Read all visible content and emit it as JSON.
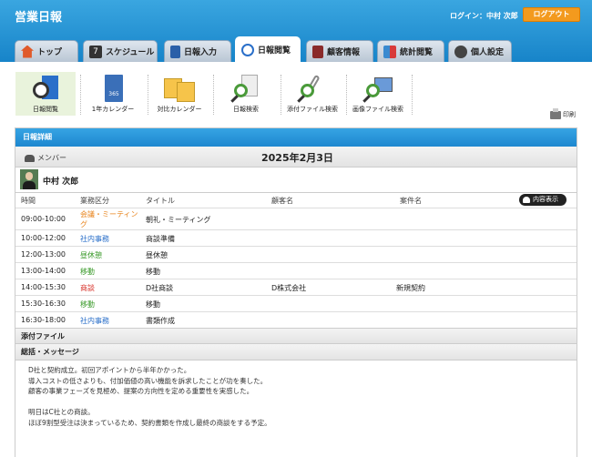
{
  "app": {
    "title": "営業日報",
    "login": "ログイン：中村 次郎",
    "logout_label": "ログアウト"
  },
  "tabs": [
    {
      "label": "トップ",
      "icon": "house-icon",
      "color": "#e05a2a"
    },
    {
      "label": "スケジュール",
      "icon": "calendar-icon",
      "color": "#333333"
    },
    {
      "label": "日報入力",
      "icon": "book-icon",
      "color": "#2a5fa8"
    },
    {
      "label": "日報閲覧",
      "icon": "clock-icon",
      "color": "#2a6fc9"
    },
    {
      "label": "顧客情報",
      "icon": "building-icon",
      "color": "#8a2a2a"
    },
    {
      "label": "統計閲覧",
      "icon": "blocks-icon",
      "color": "#3a8ad0"
    },
    {
      "label": "個人設定",
      "icon": "gear-icon",
      "color": "#444444"
    }
  ],
  "toolbar": [
    {
      "label": "日報閲覧",
      "icon": "clock-book-icon"
    },
    {
      "label": "1年カレンダー",
      "icon": "calendar-365-icon",
      "icon_text": "365"
    },
    {
      "label": "対比カレンダー",
      "icon": "compare-calendar-icon"
    },
    {
      "label": "日報検索",
      "icon": "search-document-icon"
    },
    {
      "label": "添付ファイル検索",
      "icon": "attachment-search-icon"
    },
    {
      "label": "画像ファイル検索",
      "icon": "image-search-icon"
    }
  ],
  "print_label": "印刷",
  "panel": {
    "title": "日報詳細",
    "member_label": "メンバー",
    "date": "2025年2月3日",
    "user_name": "中村 次郎",
    "columns": {
      "time": "時間",
      "category": "業務区分",
      "title": "タイトル",
      "customer": "顧客名",
      "deal": "案件名"
    },
    "detail_button": "内容表示",
    "rows": [
      {
        "time": "09:00-10:00",
        "category": "会議・ミーティング",
        "cat_color": "#e8851f",
        "title": "朝礼・ミーティング",
        "customer": "",
        "deal": ""
      },
      {
        "time": "10:00-12:00",
        "category": "社内事務",
        "cat_color": "#2a6fc9",
        "title": "商談準備",
        "customer": "",
        "deal": ""
      },
      {
        "time": "12:00-13:00",
        "category": "昼休憩",
        "cat_color": "#3a9a2a",
        "title": "昼休憩",
        "customer": "",
        "deal": ""
      },
      {
        "time": "13:00-14:00",
        "category": "移動",
        "cat_color": "#3a9a2a",
        "title": "移動",
        "customer": "",
        "deal": ""
      },
      {
        "time": "14:00-15:30",
        "category": "商談",
        "cat_color": "#d8322a",
        "title": "D社商談",
        "customer": "D株式会社",
        "deal": "新規契約"
      },
      {
        "time": "15:30-16:30",
        "category": "移動",
        "cat_color": "#3a9a2a",
        "title": "移動",
        "customer": "",
        "deal": ""
      },
      {
        "time": "16:30-18:00",
        "category": "社内事務",
        "cat_color": "#2a6fc9",
        "title": "書類作成",
        "customer": "",
        "deal": ""
      }
    ],
    "attachments_label": "添付ファイル",
    "summary_label": "総括・メッセージ",
    "summary_lines": [
      "D社と契約成立。初回アポイントから半年かかった。",
      "導入コストの低さよりも、付加価値の高い機能を訴求したことが功を奏した。",
      "顧客の事業フェーズを見極め、提案の方向性を定める重要性を実感した。",
      "",
      "明日はC社との商談。",
      "ほぼ9割型受注は決まっているため、契約書類を作成し最終の商談をする予定。"
    ]
  }
}
